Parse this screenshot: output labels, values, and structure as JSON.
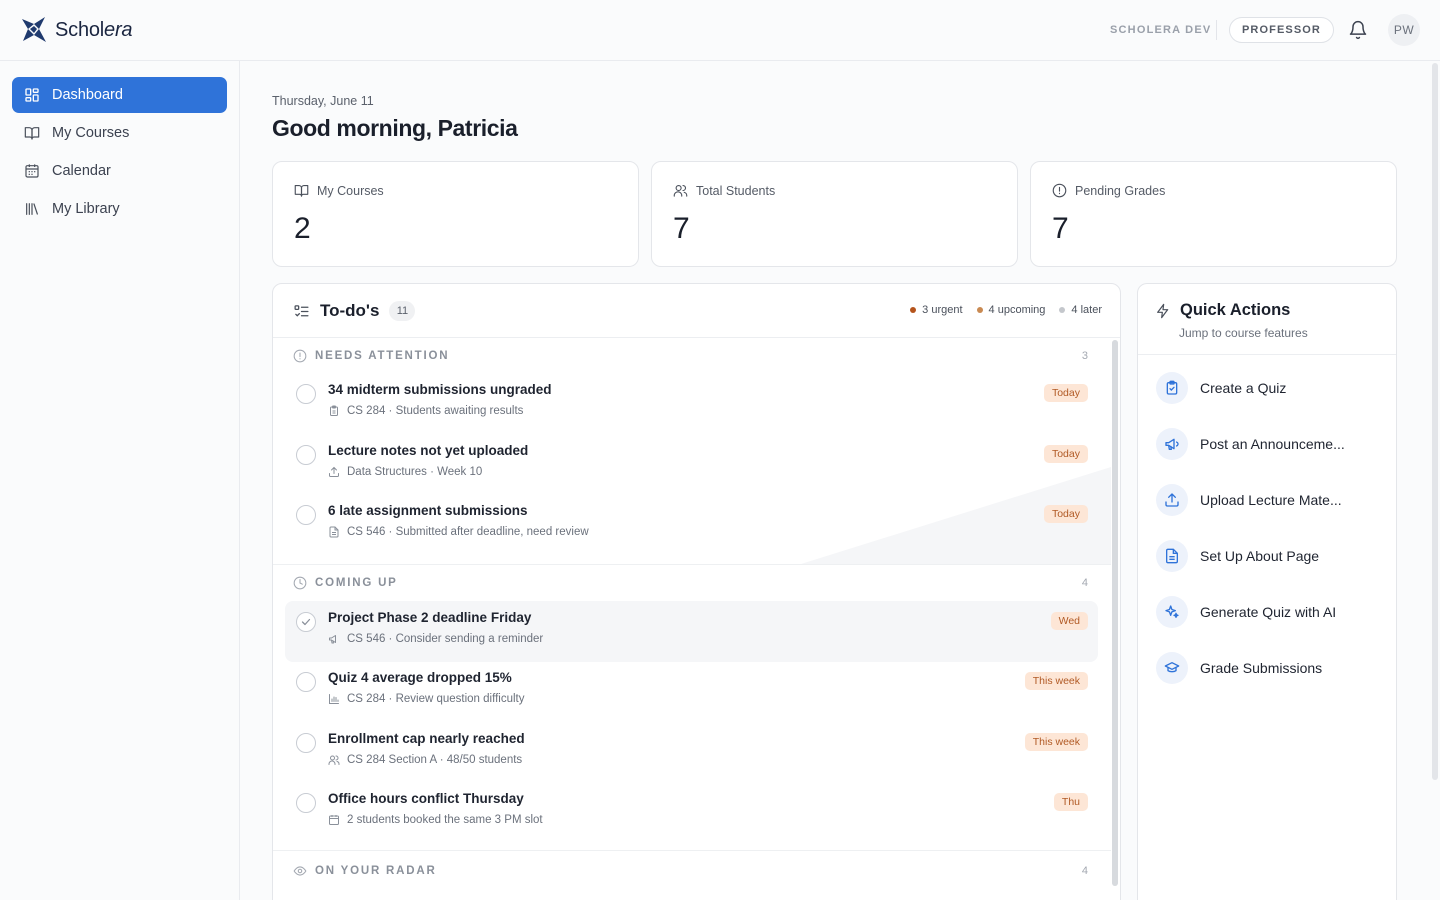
{
  "brand": {
    "name_a": "Schol",
    "name_b": "era"
  },
  "header": {
    "env": "SCHOLERA DEV",
    "role": "PROFESSOR",
    "avatar_initials": "PW"
  },
  "sidebar": {
    "items": [
      {
        "label": "Dashboard",
        "icon": "dashboard-icon",
        "active": true
      },
      {
        "label": "My Courses",
        "icon": "book-icon"
      },
      {
        "label": "Calendar",
        "icon": "calendar-icon"
      },
      {
        "label": "My Library",
        "icon": "library-icon"
      }
    ]
  },
  "main": {
    "date": "Thursday, June 11",
    "greeting": "Good morning, Patricia",
    "stats": [
      {
        "label": "My Courses",
        "value": "2",
        "icon": "book-icon"
      },
      {
        "label": "Total Students",
        "value": "7",
        "icon": "users-icon"
      },
      {
        "label": "Pending Grades",
        "value": "7",
        "icon": "alert-circle-icon"
      }
    ]
  },
  "todo": {
    "title": "To-do's",
    "count": "11",
    "legend": [
      {
        "label": "3 urgent",
        "color": "#b5541c"
      },
      {
        "label": "4 upcoming",
        "color": "#c98a52"
      },
      {
        "label": "4 later",
        "color": "#c4c7cc"
      }
    ],
    "sections": [
      {
        "title": "NEEDS ATTENTION",
        "count": "3",
        "icon": "alert-circle-icon",
        "items": [
          {
            "title": "34 midterm submissions ungraded",
            "sub": "CS 284 · Students awaiting results",
            "badge": "Today",
            "icon": "clipboard-icon"
          },
          {
            "title": "Lecture notes not yet uploaded",
            "sub": "Data Structures · Week 10",
            "badge": "Today",
            "icon": "upload-icon"
          },
          {
            "title": "6 late assignment submissions",
            "sub": "CS 546 · Submitted after deadline, need review",
            "badge": "Today",
            "icon": "file-icon"
          }
        ]
      },
      {
        "title": "COMING UP",
        "count": "4",
        "icon": "clock-icon",
        "items": [
          {
            "title": "Project Phase 2 deadline Friday",
            "sub": "CS 546 · Consider sending a reminder",
            "badge": "Wed",
            "icon": "megaphone-icon",
            "hover": true
          },
          {
            "title": "Quiz 4 average dropped 15%",
            "sub": "CS 284 · Review question difficulty",
            "badge": "This week",
            "icon": "bar-chart-icon"
          },
          {
            "title": "Enrollment cap nearly reached",
            "sub": "CS 284 Section A · 48/50 students",
            "badge": "This week",
            "icon": "users-icon"
          },
          {
            "title": "Office hours conflict Thursday",
            "sub": "2 students booked the same 3 PM slot",
            "badge": "Thu",
            "icon": "calendar-icon"
          }
        ]
      },
      {
        "title": "ON YOUR RADAR",
        "count": "4",
        "icon": "eye-icon",
        "items": []
      }
    ]
  },
  "quick_actions": {
    "title": "Quick Actions",
    "subtitle": "Jump to course features",
    "items": [
      {
        "label": "Create a Quiz",
        "icon": "clipboard-icon"
      },
      {
        "label": "Post an Announceme...",
        "icon": "megaphone-icon"
      },
      {
        "label": "Upload Lecture Mate...",
        "icon": "upload-icon"
      },
      {
        "label": "Set Up About Page",
        "icon": "file-icon"
      },
      {
        "label": "Generate Quiz with AI",
        "icon": "sparkle-icon"
      },
      {
        "label": "Grade Submissions",
        "icon": "graduation-cap-icon"
      }
    ]
  },
  "colors": {
    "accent": "#2f73d9",
    "badge_bg": "#fde6d6",
    "badge_text": "#b15a25"
  }
}
